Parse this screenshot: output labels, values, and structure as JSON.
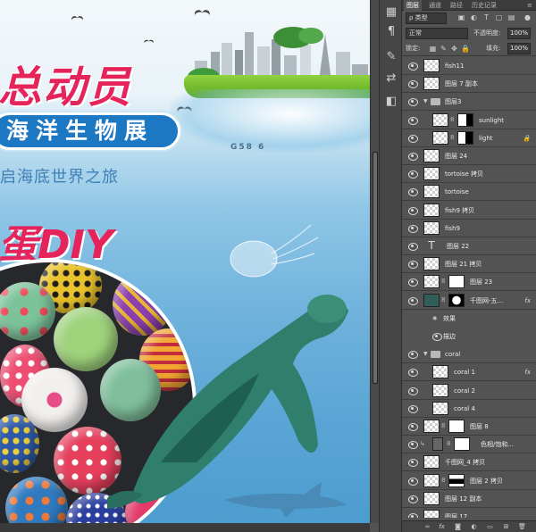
{
  "canvas": {
    "title_main": "总动员",
    "sub_banner": "海洋生物展",
    "slogan": "启海底世界之旅",
    "diy_title": "蛋DIY",
    "sign_text": "G58 6"
  },
  "panel": {
    "tabs": [
      "图层",
      "通道",
      "路径",
      "历史记录"
    ],
    "filter": {
      "label": "ρ 类型",
      "icons": [
        "image-filter-icon",
        "adjust-filter-icon",
        "type-filter-icon",
        "shape-filter-icon",
        "smart-filter-icon"
      ]
    },
    "blend_mode": "正常",
    "opacity_label": "不透明度:",
    "opacity_value": "100%",
    "lock_label": "锁定:",
    "fill_label": "填充:",
    "fill_value": "100%",
    "layers": [
      {
        "name": "fish11",
        "type": "pixel",
        "indent": 0
      },
      {
        "name": "图层 7 副本",
        "type": "pixel",
        "indent": 0
      },
      {
        "name": "图层3",
        "type": "group",
        "indent": 0,
        "open": true
      },
      {
        "name": "sunlight",
        "type": "pixel-mask",
        "indent": 1
      },
      {
        "name": "light",
        "type": "pixel-mask",
        "indent": 1,
        "locked": true
      },
      {
        "name": "图层 24",
        "type": "pixel",
        "indent": 0
      },
      {
        "name": "tortoise 拷贝",
        "type": "pixel",
        "indent": 0
      },
      {
        "name": "tortoise",
        "type": "pixel",
        "indent": 0
      },
      {
        "name": "fish9 拷贝",
        "type": "pixel",
        "indent": 0
      },
      {
        "name": "fish9",
        "type": "pixel",
        "indent": 0
      },
      {
        "name": "图层 22",
        "type": "text",
        "indent": 0
      },
      {
        "name": "图层 21 拷贝",
        "type": "pixel",
        "indent": 0
      },
      {
        "name": "图层 23",
        "type": "pixel-mask",
        "indent": 0
      },
      {
        "name": "千图网-五...",
        "type": "smart-mask",
        "indent": 0,
        "fx": true
      },
      {
        "name": "效果",
        "type": "effect-header",
        "indent": 1
      },
      {
        "name": "描边",
        "type": "effect",
        "indent": 2
      },
      {
        "name": "coral",
        "type": "group",
        "indent": 0,
        "open": true
      },
      {
        "name": "coral 1",
        "type": "pixel",
        "indent": 1,
        "fx": true
      },
      {
        "name": "coral 2",
        "type": "pixel",
        "indent": 1
      },
      {
        "name": "coral 4",
        "type": "pixel",
        "indent": 1
      },
      {
        "name": "图层 8",
        "type": "pixel-mask",
        "indent": 0
      },
      {
        "name": "色相/饱和...",
        "type": "adjustment",
        "indent": 0,
        "clip": true
      },
      {
        "name": "千图网_4 拷贝",
        "type": "pixel",
        "indent": 0
      },
      {
        "name": "图层 2 拷贝",
        "type": "pixel-mask-dark",
        "indent": 0
      },
      {
        "name": "图层 12 副本",
        "type": "pixel",
        "indent": 0
      },
      {
        "name": "图层 17",
        "type": "pixel",
        "indent": 0
      }
    ],
    "footer_icons": [
      "link-layers-icon",
      "fx-icon",
      "add-mask-icon",
      "adjustment-layer-icon",
      "new-group-icon",
      "new-layer-icon",
      "trash-icon"
    ],
    "fx_label": "fx"
  },
  "colors": {
    "accent_pink": "#e4245b",
    "banner_blue": "#1d78c4",
    "panel_bg": "#535353"
  }
}
